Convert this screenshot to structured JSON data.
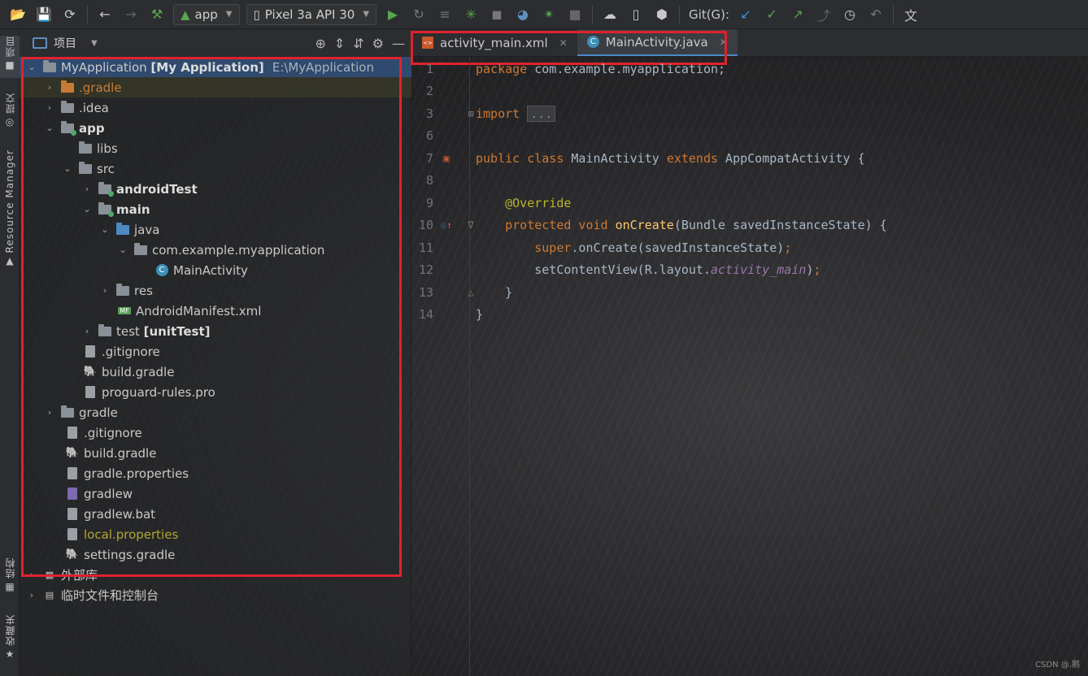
{
  "toolbar": {
    "run_config": "app",
    "device": "Pixel 3a API 30",
    "git_label": "Git(G):"
  },
  "left_strip": {
    "project_tab": "项目",
    "commit_tab": "提交",
    "resource_manager_tab": "Resource Manager",
    "structure_tab": "结构",
    "favorites_tab": "收藏夹"
  },
  "project_panel": {
    "title": "项目",
    "tree": [
      {
        "label": "MyApplication",
        "extra": "[My Application]",
        "path": "E:\\MyApplication"
      },
      {
        "label": ".gradle"
      },
      {
        "label": ".idea"
      },
      {
        "label": "app"
      },
      {
        "label": "libs"
      },
      {
        "label": "src"
      },
      {
        "label": "androidTest"
      },
      {
        "label": "main"
      },
      {
        "label": "java"
      },
      {
        "label": "com.example.myapplication"
      },
      {
        "label": "MainActivity"
      },
      {
        "label": "res"
      },
      {
        "label": "AndroidManifest.xml"
      },
      {
        "label": "test",
        "extra": "[unitTest]"
      },
      {
        "label": ".gitignore"
      },
      {
        "label": "build.gradle"
      },
      {
        "label": "proguard-rules.pro"
      },
      {
        "label": "gradle"
      },
      {
        "label": ".gitignore"
      },
      {
        "label": "build.gradle"
      },
      {
        "label": "gradle.properties"
      },
      {
        "label": "gradlew"
      },
      {
        "label": "gradlew.bat"
      },
      {
        "label": "local.properties"
      },
      {
        "label": "settings.gradle"
      },
      {
        "label": "外部库"
      },
      {
        "label": "临时文件和控制台"
      }
    ]
  },
  "editor": {
    "tabs": [
      {
        "label": "activity_main.xml"
      },
      {
        "label": "MainActivity.java"
      }
    ],
    "line_numbers": [
      "1",
      "2",
      "3",
      "6",
      "7",
      "8",
      "9",
      "10",
      "11",
      "12",
      "13",
      "14"
    ],
    "code": {
      "l1_kw": "package",
      "l1_rest": " com.example.myapplication;",
      "l3_kw": "import",
      "l3_fold": "...",
      "l7_kw1": "public class",
      "l7_name": " MainActivity ",
      "l7_kw2": "extends",
      "l7_rest": " AppCompatActivity {",
      "l9_ann": "@Override",
      "l10_kw": "protected void",
      "l10_fn": " onCreate",
      "l10_rest": "(Bundle savedInstanceState) {",
      "l11_kw": "super",
      "l11_rest": ".onCreate(savedInstanceState)",
      "l11_semi": ";",
      "l12_a": "setContentView(R.layout.",
      "l12_it": "activity_main",
      "l12_b": ")",
      "l12_semi": ";",
      "l13": "}",
      "l14": "}"
    }
  },
  "watermark": "CSDN @.鹅"
}
